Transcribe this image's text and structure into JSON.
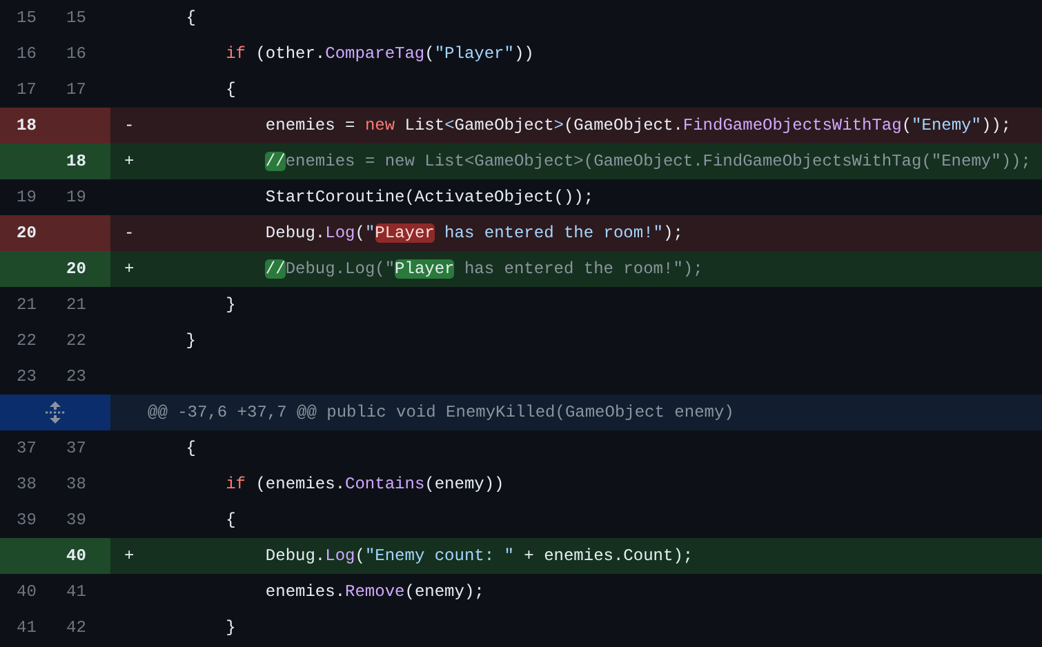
{
  "diff": {
    "lines": [
      {
        "kind": "context",
        "old": "15",
        "new": "15",
        "tokens": [
          {
            "text": "    {",
            "kind": "plain"
          }
        ]
      },
      {
        "kind": "context",
        "old": "16",
        "new": "16",
        "tokens": [
          {
            "text": "        if",
            "kind": "keyword"
          },
          {
            "text": " (other.",
            "kind": "plain"
          },
          {
            "text": "CompareTag",
            "kind": "func"
          },
          {
            "text": "(",
            "kind": "plain"
          },
          {
            "text": "\"Player\"",
            "kind": "string"
          },
          {
            "text": "))",
            "kind": "plain"
          }
        ]
      },
      {
        "kind": "context",
        "old": "17",
        "new": "17",
        "tokens": [
          {
            "text": "        {",
            "kind": "plain"
          }
        ]
      },
      {
        "kind": "del",
        "old": "18",
        "sign": "-",
        "tokens": [
          {
            "text": "            enemies = ",
            "kind": "plain"
          },
          {
            "text": "new",
            "kind": "keyword"
          },
          {
            "text": " List",
            "kind": "plain"
          },
          {
            "text": "<",
            "kind": "op"
          },
          {
            "text": "GameObject",
            "kind": "plain"
          },
          {
            "text": ">",
            "kind": "op"
          },
          {
            "text": "(GameObject.",
            "kind": "plain"
          },
          {
            "text": "FindGameObjectsWithTag",
            "kind": "func"
          },
          {
            "text": "(",
            "kind": "plain"
          },
          {
            "text": "\"Enemy\"",
            "kind": "string"
          },
          {
            "text": "));",
            "kind": "plain"
          }
        ]
      },
      {
        "kind": "add",
        "new": "18",
        "sign": "+",
        "tokens": [
          {
            "text": "            //",
            "kind": "comment",
            "highlight": true
          },
          {
            "text": "enemies = new List<GameObject>(GameObject.FindGameObjectsWithTag(\"Enemy\"));",
            "kind": "comment"
          }
        ]
      },
      {
        "kind": "context",
        "old": "19",
        "new": "19",
        "tokens": [
          {
            "text": "            StartCoroutine(ActivateObject());",
            "kind": "plain"
          }
        ]
      },
      {
        "kind": "del",
        "old": "20",
        "sign": "-",
        "tokens": [
          {
            "text": "            Debug.",
            "kind": "plain"
          },
          {
            "text": "Log",
            "kind": "func"
          },
          {
            "text": "(",
            "kind": "plain"
          },
          {
            "text": "\"",
            "kind": "string"
          },
          {
            "text": "PLayer",
            "kind": "string",
            "highlight": true
          },
          {
            "text": " has entered the room!\"",
            "kind": "string"
          },
          {
            "text": ");",
            "kind": "plain"
          }
        ]
      },
      {
        "kind": "add",
        "new": "20",
        "sign": "+",
        "tokens": [
          {
            "text": "            //",
            "kind": "comment",
            "highlight": true
          },
          {
            "text": "Debug.Log(\"",
            "kind": "comment"
          },
          {
            "text": "Player",
            "kind": "comment",
            "highlight": true
          },
          {
            "text": " has entered the room!\");",
            "kind": "comment"
          }
        ]
      },
      {
        "kind": "context",
        "old": "21",
        "new": "21",
        "tokens": [
          {
            "text": "        }",
            "kind": "plain"
          }
        ]
      },
      {
        "kind": "context",
        "old": "22",
        "new": "22",
        "tokens": [
          {
            "text": "    }",
            "kind": "plain"
          }
        ]
      },
      {
        "kind": "context",
        "old": "23",
        "new": "23"
      },
      {
        "kind": "hunk",
        "header": "@@ -37,6 +37,7 @@ public void EnemyKilled(GameObject enemy)"
      },
      {
        "kind": "context",
        "old": "37",
        "new": "37",
        "tokens": [
          {
            "text": "    {",
            "kind": "plain"
          }
        ]
      },
      {
        "kind": "context",
        "old": "38",
        "new": "38",
        "tokens": [
          {
            "text": "        if",
            "kind": "keyword"
          },
          {
            "text": " (enemies.",
            "kind": "plain"
          },
          {
            "text": "Contains",
            "kind": "func"
          },
          {
            "text": "(enemy))",
            "kind": "plain"
          }
        ]
      },
      {
        "kind": "context",
        "old": "39",
        "new": "39",
        "tokens": [
          {
            "text": "        {",
            "kind": "plain"
          }
        ]
      },
      {
        "kind": "add",
        "new": "40",
        "sign": "+",
        "tokens": [
          {
            "text": "            Debug.",
            "kind": "plain"
          },
          {
            "text": "Log",
            "kind": "func"
          },
          {
            "text": "(",
            "kind": "plain"
          },
          {
            "text": "\"Enemy count: \"",
            "kind": "string"
          },
          {
            "text": " + enemies.Count);",
            "kind": "plain"
          }
        ]
      },
      {
        "kind": "context",
        "old": "40",
        "new": "41",
        "tokens": [
          {
            "text": "            enemies.",
            "kind": "plain"
          },
          {
            "text": "Remove",
            "kind": "func"
          },
          {
            "text": "(enemy);",
            "kind": "plain"
          }
        ]
      },
      {
        "kind": "context",
        "old": "41",
        "new": "42",
        "tokens": [
          {
            "text": "        }",
            "kind": "plain"
          }
        ]
      }
    ]
  }
}
